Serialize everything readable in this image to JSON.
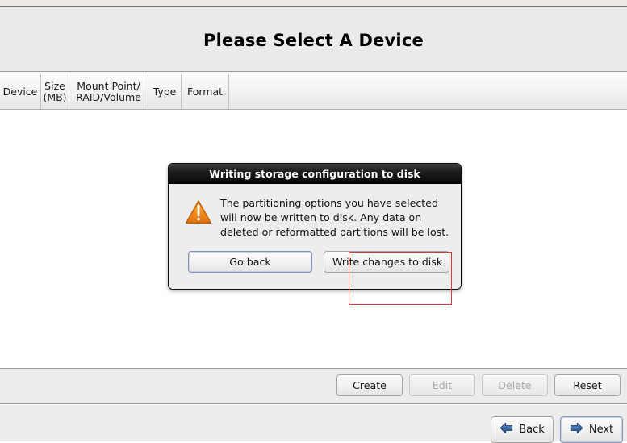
{
  "header": {
    "title": "Please Select A Device"
  },
  "table": {
    "columns": [
      {
        "label": "Device"
      },
      {
        "label": "Size\n(MB)"
      },
      {
        "label": "Mount Point/\nRAID/Volume"
      },
      {
        "label": "Type"
      },
      {
        "label": "Format"
      }
    ]
  },
  "dialog": {
    "title": "Writing storage configuration to disk",
    "icon": "warning-triangle-icon",
    "message": "The partitioning options you have selected will now be written to disk.  Any data on deleted or reformatted partitions will be lost.",
    "buttons": {
      "go_back": "Go back",
      "write_changes": "Write changes to disk"
    }
  },
  "action_bar": {
    "create": "Create",
    "edit": "Edit",
    "delete": "Delete",
    "reset": "Reset"
  },
  "nav_bar": {
    "back": "Back",
    "next": "Next"
  },
  "colors": {
    "accent_blue": "#2b5fa8",
    "warning_orange": "#f0881e",
    "highlight_red": "#d93b3b",
    "titlebar_black": "#0b0b0b",
    "panel_gray": "#ececec"
  }
}
